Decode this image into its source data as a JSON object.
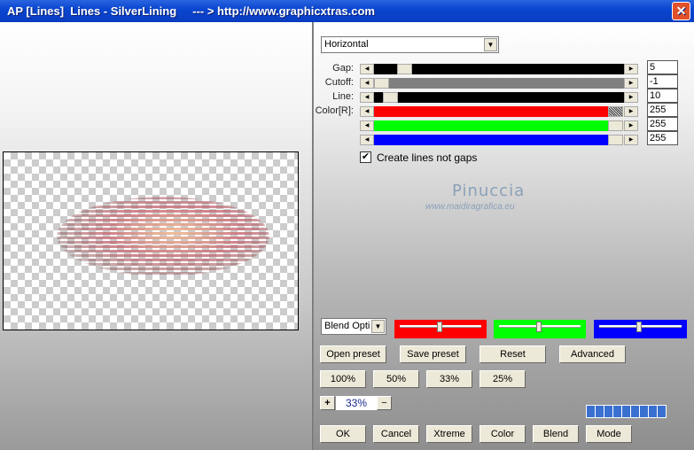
{
  "window": {
    "title": "AP [Lines]  Lines - SilverLining     --- > http://www.graphicxtras.com",
    "close_icon": "close-icon"
  },
  "direction": {
    "value": "Horizontal"
  },
  "sliders": [
    {
      "label": "Gap:",
      "value": "5",
      "fill": "#000000"
    },
    {
      "label": "Cutoff:",
      "value": "-1",
      "fill": "#808080"
    },
    {
      "label": "Line:",
      "value": "10",
      "fill": "#000000"
    },
    {
      "label": "Color[R]:",
      "value": "255",
      "fill": "#ff0000"
    },
    {
      "label": "",
      "value": "255",
      "fill": "#00ff00"
    },
    {
      "label": "",
      "value": "255",
      "fill": "#0000ff"
    }
  ],
  "checkbox": {
    "label": "Create lines not gaps",
    "checked": true
  },
  "watermark": {
    "name": "Pinuccia",
    "url": "www.maidiragrafica.eu"
  },
  "blend": {
    "value": "Blend Opti"
  },
  "buttons": {
    "open_preset": "Open preset",
    "save_preset": "Save preset",
    "reset": "Reset",
    "advanced": "Advanced",
    "z100": "100%",
    "z50": "50%",
    "z33": "33%",
    "z25": "25%",
    "plus": "+",
    "minus": "−",
    "ok": "OK",
    "cancel": "Cancel",
    "xtreme": "Xtreme",
    "color": "Color",
    "blend": "Blend",
    "mode": "Mode"
  },
  "zoom": {
    "value": "33%"
  }
}
